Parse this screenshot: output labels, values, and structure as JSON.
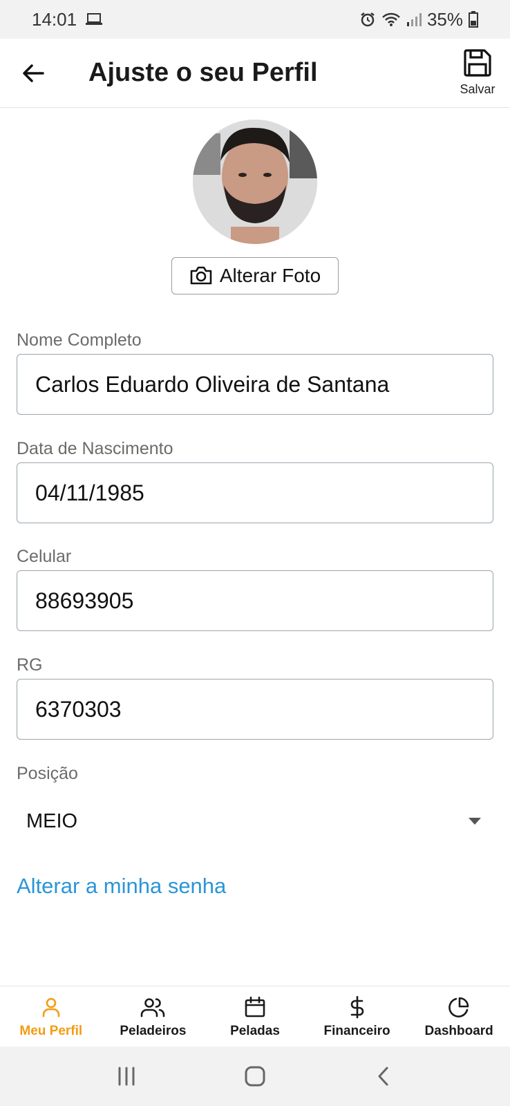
{
  "status_bar": {
    "time": "14:01",
    "battery": "35%"
  },
  "app_bar": {
    "title": "Ajuste o seu Perfil",
    "save_label": "Salvar"
  },
  "profile": {
    "change_photo_label": "Alterar Foto"
  },
  "form": {
    "name": {
      "label": "Nome Completo",
      "value": "Carlos Eduardo Oliveira de Santana"
    },
    "birth": {
      "label": "Data de Nascimento",
      "value": "04/11/1985"
    },
    "phone": {
      "label": "Celular",
      "value": "88693905"
    },
    "rg": {
      "label": "RG",
      "value": "6370303"
    },
    "position": {
      "label": "Posição",
      "value": "MEIO"
    }
  },
  "change_password_link": "Alterar a minha senha",
  "bottom_nav": {
    "items": [
      {
        "label": "Meu Perfil",
        "icon": "user-icon",
        "active": true
      },
      {
        "label": "Peladeiros",
        "icon": "users-icon"
      },
      {
        "label": "Peladas",
        "icon": "calendar-icon"
      },
      {
        "label": "Financeiro",
        "icon": "dollar-icon"
      },
      {
        "label": "Dashboard",
        "icon": "pie-chart-icon"
      }
    ]
  },
  "colors": {
    "accent": "#f39c12",
    "link": "#2b95d6"
  }
}
